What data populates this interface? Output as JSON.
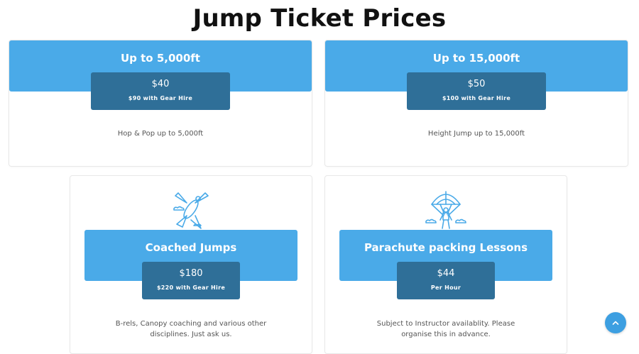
{
  "page": {
    "title": "Jump Ticket Prices"
  },
  "cards": [
    {
      "heading": "Up to 5,000ft",
      "price": "$40",
      "price_note": "$90 with Gear Hire",
      "description": "Hop & Pop up to 5,000ft"
    },
    {
      "heading": "Up to 15,000ft",
      "price": "$50",
      "price_note": "$100 with Gear Hire",
      "description": "Height Jump up to 15,000ft"
    },
    {
      "heading": "Coached Jumps",
      "icon": "skydiver-icon",
      "price": "$180",
      "price_note": "$220 with Gear Hire",
      "description_line1": "B-rels, Canopy coaching and various other",
      "description_line2": "disciplines. Just ask us."
    },
    {
      "heading": "Parachute packing Lessons",
      "icon": "parachute-icon",
      "price": "$44",
      "price_note": "Per Hour",
      "description_line1": "Subject to  Instructor availablity. Please",
      "description_line2": "organise this in advance."
    }
  ],
  "scroll_top": {
    "icon": "chevron-up-icon"
  },
  "colors": {
    "band": "#4aaae8",
    "price_box": "#2f6f98",
    "icon_stroke": "#4aaae8",
    "scroll_button": "#3d9fe1"
  }
}
